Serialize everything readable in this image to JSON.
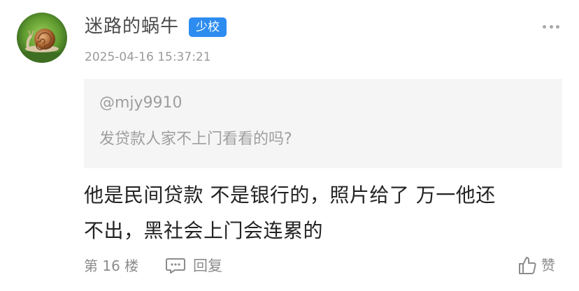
{
  "author": {
    "name": "迷路的蜗牛",
    "badge": "少校",
    "timestamp": "2025-04-16 15:37:21"
  },
  "quote": {
    "user": "@mjy9910",
    "text": "发贷款人家不上门看看的吗?"
  },
  "content": {
    "line1": "他是民间贷款 不是银行的，照片给了 万一他还",
    "line2": "不出，黑社会上门会连累的"
  },
  "footer": {
    "floor": "第 16 楼",
    "reply_label": "回复",
    "like_label": "赞"
  },
  "icons": {
    "more": "more-dots-icon",
    "reply": "comment-icon",
    "like": "thumbs-up-icon"
  },
  "colors": {
    "badge": "#2d8cf0",
    "quote_background": "#f5f5f5"
  }
}
